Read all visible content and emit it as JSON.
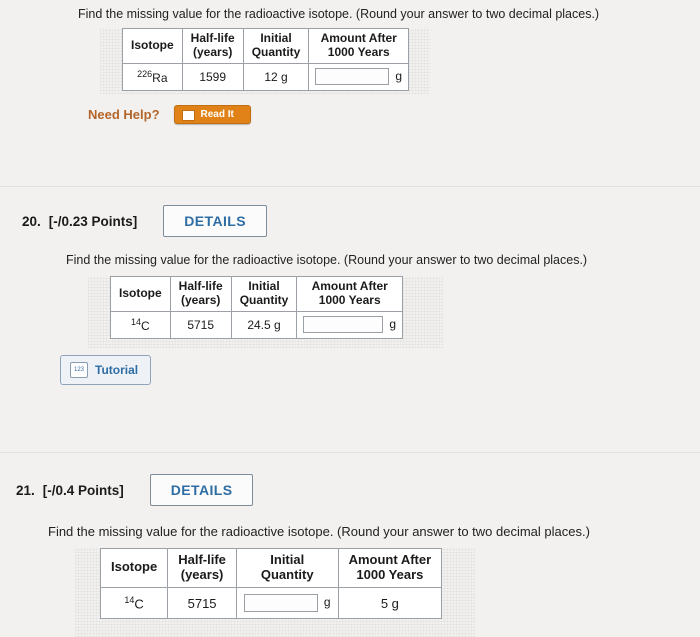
{
  "questions": [
    {
      "prompt": "Find the missing value for the radioactive isotope. (Round your answer to two decimal places.)",
      "table": {
        "headers": [
          "Isotope",
          "Half-life (years)",
          "Initial Quantity",
          "Amount After 1000 Years"
        ],
        "headers_multiline": [
          [
            "Isotope"
          ],
          [
            "Half-life",
            "(years)"
          ],
          [
            "Initial",
            "Quantity"
          ],
          [
            "Amount After",
            "1000 Years"
          ]
        ],
        "row": {
          "isotope_mass": "226",
          "isotope_symbol": "Ra",
          "half_life": "1599",
          "initial_quantity": "12 g",
          "amount_after": "",
          "amount_unit": "g"
        }
      },
      "need_help_label": "Need Help?",
      "read_it_label": "Read It"
    },
    {
      "number": "20.",
      "points": "[-/0.23 Points]",
      "details_label": "DETAILS",
      "prompt": "Find the missing value for the radioactive isotope. (Round your answer to two decimal places.)",
      "table": {
        "headers_multiline": [
          [
            "Isotope"
          ],
          [
            "Half-life",
            "(years)"
          ],
          [
            "Initial",
            "Quantity"
          ],
          [
            "Amount After",
            "1000 Years"
          ]
        ],
        "row": {
          "isotope_mass": "14",
          "isotope_symbol": "C",
          "half_life": "5715",
          "initial_quantity": "24.5 g",
          "amount_after": "",
          "amount_unit": "g"
        }
      },
      "tutorial_label": "Tutorial",
      "tutorial_icon_text": "123"
    },
    {
      "number": "21.",
      "points": "[-/0.4 Points]",
      "details_label": "DETAILS",
      "prompt": "Find the missing value for the radioactive isotope. (Round your answer to two decimal places.)",
      "table": {
        "headers_multiline": [
          [
            "Isotope"
          ],
          [
            "Half-life",
            "(years)"
          ],
          [
            "Initial",
            "Quantity"
          ],
          [
            "Amount After",
            "1000 Years"
          ]
        ],
        "row": {
          "isotope_mass": "14",
          "isotope_symbol": "C",
          "half_life": "5715",
          "initial_quantity": "",
          "initial_unit": "g",
          "amount_after": "5 g"
        }
      }
    }
  ]
}
